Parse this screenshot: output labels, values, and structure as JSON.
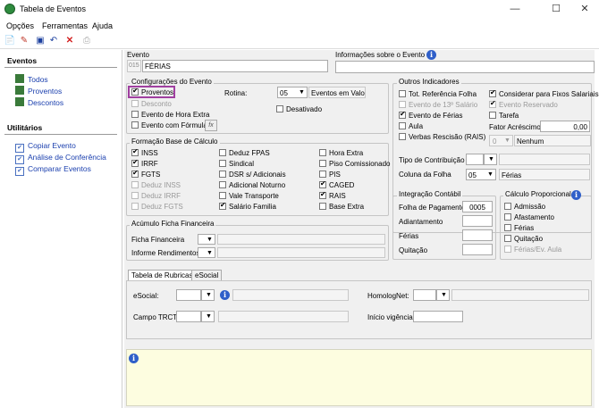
{
  "window": {
    "title": "Tabela de Eventos",
    "minimize": "—",
    "maximize": "☐",
    "close": "✕"
  },
  "menu": [
    "Opções",
    "Ferramentas",
    "Ajuda"
  ],
  "sidebar": {
    "eventos_header": "Eventos",
    "eventos_items": [
      "Todos",
      "Proventos",
      "Descontos"
    ],
    "util_header": "Utilitários",
    "util_items": [
      "Copiar Evento",
      "Análise de Conferência",
      "Comparar Eventos"
    ]
  },
  "evento": {
    "label": "Evento",
    "code": "015",
    "name": "FÉRIAS"
  },
  "info_evento": {
    "label": "Informações sobre o Evento"
  },
  "config": {
    "title": "Configurações do Evento",
    "proventos": "Proventos",
    "desconto": "Desconto",
    "hora_extra": "Evento de Hora Extra",
    "formula": "Evento com Fórmula",
    "fx": "fx",
    "rotina_label": "Rotina:",
    "rotina_value": "05",
    "rotina_desc": "Eventos em Valor",
    "desativado": "Desativado"
  },
  "formacao": {
    "title": "Formação Base de Cálculo",
    "col1": [
      {
        "l": "INSS",
        "c": true
      },
      {
        "l": "IRRF",
        "c": true
      },
      {
        "l": "FGTS",
        "c": true
      },
      {
        "l": "Deduz INSS",
        "c": false,
        "g": true
      },
      {
        "l": "Deduz IRRF",
        "c": false,
        "g": true
      },
      {
        "l": "Deduz FGTS",
        "c": false,
        "g": true
      }
    ],
    "col2": [
      {
        "l": "Deduz FPAS",
        "c": false
      },
      {
        "l": "Sindical",
        "c": false
      },
      {
        "l": "DSR s/ Adicionais",
        "c": false
      },
      {
        "l": "Adicional Noturno",
        "c": false
      },
      {
        "l": "Vale Transporte",
        "c": false
      },
      {
        "l": "Salário Familia",
        "c": true
      }
    ],
    "col3": [
      {
        "l": "Hora Extra",
        "c": false
      },
      {
        "l": "Piso Comissionado",
        "c": false
      },
      {
        "l": "PIS",
        "c": false
      },
      {
        "l": "CAGED",
        "c": true
      },
      {
        "l": "RAIS",
        "c": true
      },
      {
        "l": "Base Extra",
        "c": false
      }
    ]
  },
  "acumulo": {
    "title": "Acúmulo Ficha Financeira",
    "ficha": "Ficha Financeira",
    "informe": "Informe Rendimentos"
  },
  "outros": {
    "title": "Outros Indicadores",
    "left": [
      {
        "l": "Tot. Referência Folha",
        "c": false,
        "g": false
      },
      {
        "l": "Evento de 13º Salário",
        "c": false,
        "g": true
      },
      {
        "l": "Evento de Férias",
        "c": true,
        "g": false
      },
      {
        "l": "Aula",
        "c": false,
        "g": false
      },
      {
        "l": "Verbas Rescisão (RAIS)",
        "c": false,
        "g": false
      }
    ],
    "right": [
      {
        "l": "Considerar para Fixos Salariais",
        "c": true,
        "g": false
      },
      {
        "l": "Evento Reservado",
        "c": true,
        "g": true
      },
      {
        "l": "Tarefa",
        "c": false,
        "g": false
      }
    ],
    "fator_label": "Fator Acréscimo",
    "fator_value": "0,00",
    "nenhum_value": "0",
    "nenhum": "Nenhum",
    "tipo_contrib": "Tipo de Contribuição",
    "coluna_folha": "Coluna da Folha",
    "coluna_value": "05",
    "coluna_desc": "Férias"
  },
  "integracao": {
    "title": "Integração Contábil",
    "folha": "Folha de Pagamento",
    "folha_value": "0005",
    "adiantamento": "Adiantamento",
    "ferias": "Férias",
    "quitacao": "Quitação"
  },
  "calculo": {
    "title": "Cálculo Proporcional",
    "items": [
      {
        "l": "Admissão",
        "g": false
      },
      {
        "l": "Afastamento",
        "g": false
      },
      {
        "l": "Férias",
        "g": false
      },
      {
        "l": "Quitação",
        "g": false
      },
      {
        "l": "Férias/Ev. Aula",
        "g": true
      }
    ]
  },
  "tabs": [
    "Tabela de Rubricas",
    "eSocial"
  ],
  "rubricas": {
    "esocial": "eSocial:",
    "homolognet": "HomologNet:",
    "campo_trct": "Campo TRCT:",
    "inicio": "Início vigência:"
  },
  "colors": {
    "accent": "#2f5fc9",
    "highlight": "#a040a0",
    "notes_bg": "#fdfde0"
  }
}
